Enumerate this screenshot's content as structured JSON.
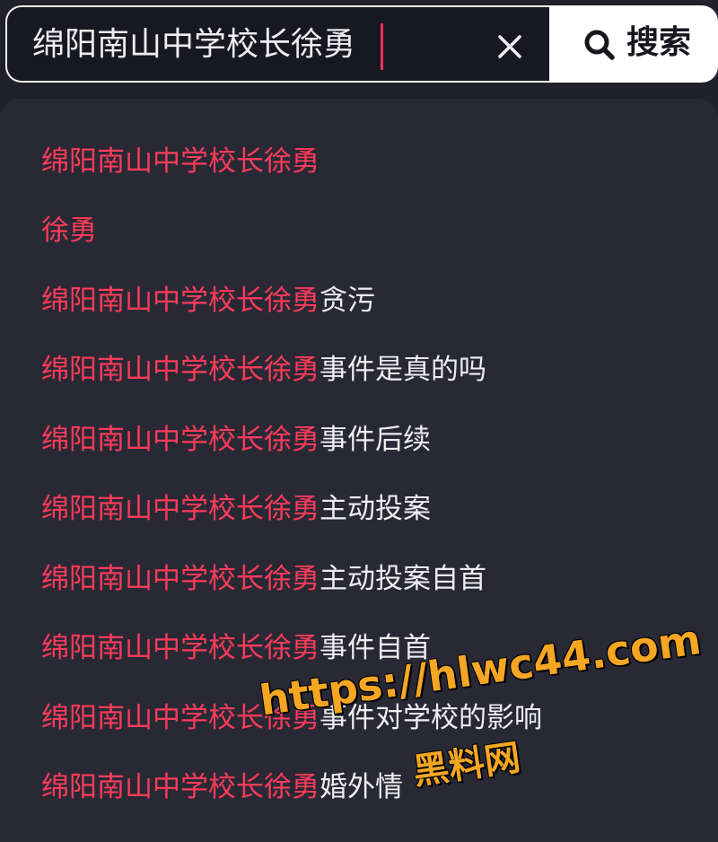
{
  "search": {
    "query": "绵阳南山中学校长徐勇",
    "button_label": "搜索",
    "clear_icon": "close-icon",
    "search_icon": "search-icon"
  },
  "suggestions": [
    {
      "highlight": "绵阳南山中学校长徐勇",
      "rest": ""
    },
    {
      "highlight": "徐勇",
      "rest": ""
    },
    {
      "highlight": "绵阳南山中学校长徐勇",
      "rest": "贪污"
    },
    {
      "highlight": "绵阳南山中学校长徐勇",
      "rest": "事件是真的吗"
    },
    {
      "highlight": "绵阳南山中学校长徐勇",
      "rest": "事件后续"
    },
    {
      "highlight": "绵阳南山中学校长徐勇",
      "rest": "主动投案"
    },
    {
      "highlight": "绵阳南山中学校长徐勇",
      "rest": "主动投案自首"
    },
    {
      "highlight": "绵阳南山中学校长徐勇",
      "rest": "事件自首"
    },
    {
      "highlight": "绵阳南山中学校长徐勇",
      "rest": "事件对学校的影响"
    },
    {
      "highlight": "绵阳南山中学校长徐勇",
      "rest": "婚外情"
    }
  ],
  "watermark": {
    "url": "https://hlwc44.com",
    "name": "黑料网"
  },
  "colors": {
    "highlight": "#ff3b5a",
    "text": "#eeeef2",
    "panel": "#282935",
    "background": "#20212b",
    "watermark": "#f5a623"
  }
}
